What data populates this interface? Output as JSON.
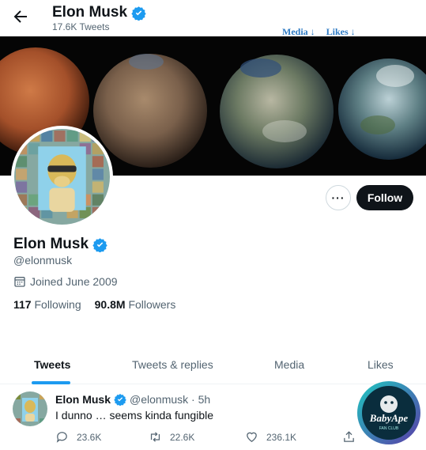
{
  "header": {
    "name": "Elon Musk",
    "tweet_count": "17.6K Tweets",
    "overlay_links": [
      "Media ↓",
      "Likes ↓"
    ]
  },
  "banner": {
    "description_icons": [
      "mars-planet",
      "terraforming-planet",
      "earth-like-planet",
      "earth-planet"
    ]
  },
  "profile": {
    "more_label": "···",
    "follow_label": "Follow",
    "name": "Elon Musk",
    "handle": "@elonmusk",
    "joined": "Joined June 2009",
    "following_count": "117",
    "following_label": "Following",
    "followers_count": "90.8M",
    "followers_label": "Followers"
  },
  "tabs": [
    "Tweets",
    "Tweets & replies",
    "Media",
    "Likes"
  ],
  "tweet": {
    "name": "Elon Musk",
    "handle_time": "@elonmusk · 5h",
    "text": "I dunno … seems kinda fungible",
    "replies": "23.6K",
    "retweets": "22.6K",
    "likes": "236.1K"
  },
  "watermark": {
    "line1": "BabyApe",
    "line2": "FAN CLUB"
  },
  "colors": {
    "accent": "#1d9bf0",
    "text": "#0f1419",
    "muted": "#536471",
    "overlay_link": "#2f7bc4"
  }
}
